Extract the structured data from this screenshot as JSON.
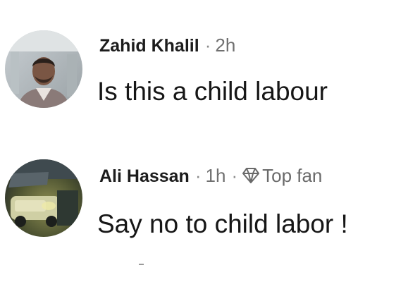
{
  "comments": [
    {
      "author": "Zahid Khalil",
      "separator": "·",
      "time": "2h",
      "text": "Is this a child labour",
      "avatar_icon": "person-avatar-icon"
    },
    {
      "author": "Ali Hassan",
      "separator": "·",
      "time": "1h",
      "separator2": "·",
      "badge_icon": "diamond-icon",
      "badge_label": "Top fan",
      "text": "Say no to child labor !",
      "avatar_icon": "car-photo-avatar-icon"
    }
  ],
  "colors": {
    "name": "#1c1c1c",
    "meta": "#707070",
    "text": "#161616",
    "background": "#ffffff"
  }
}
